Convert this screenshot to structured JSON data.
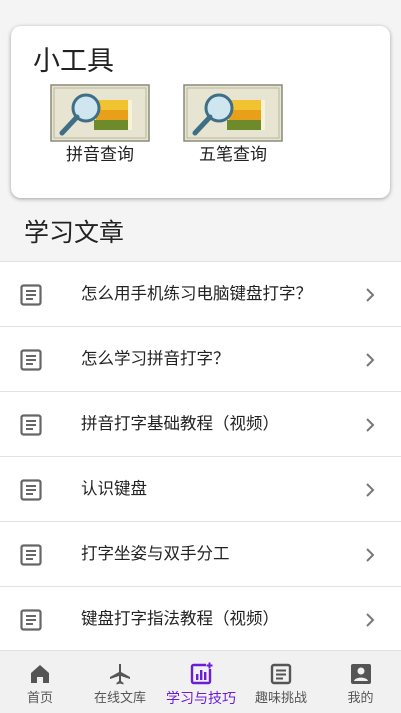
{
  "tools": {
    "title": "小工具",
    "items": [
      {
        "label": "拼音查询",
        "icon": "book-magnifier-icon"
      },
      {
        "label": "五笔查询",
        "icon": "book-magnifier-icon"
      }
    ]
  },
  "articles": {
    "title": "学习文章",
    "items": [
      {
        "text": "怎么用手机练习电脑键盘打字？"
      },
      {
        "text": "怎么学习拼音打字？"
      },
      {
        "text": "拼音打字基础教程（视频）"
      },
      {
        "text": "认识键盘"
      },
      {
        "text": "打字坐姿与双手分工"
      },
      {
        "text": "键盘打字指法教程（视频）"
      }
    ]
  },
  "nav": {
    "active_color": "#6a1ed8",
    "items": [
      {
        "label": "首页",
        "icon": "home-icon"
      },
      {
        "label": "在线文库",
        "icon": "airplane-icon"
      },
      {
        "label": "学习与技巧",
        "icon": "chart-icon",
        "active": true
      },
      {
        "label": "趣味挑战",
        "icon": "list-icon"
      },
      {
        "label": "我的",
        "icon": "profile-icon"
      }
    ]
  }
}
